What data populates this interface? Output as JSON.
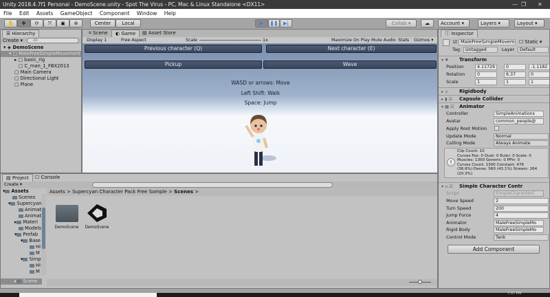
{
  "window": {
    "title": "Unity 2018.4.7f1 Personal - DemoScene.unity - Spot The Virus - PC, Mac & Linux Standalone <DX11>",
    "minimize": "—",
    "maximize": "❐",
    "close": "✕"
  },
  "menu": [
    "File",
    "Edit",
    "Assets",
    "GameObject",
    "Component",
    "Window",
    "Help"
  ],
  "toolbar": {
    "tools": [
      "hand-tool",
      "move-tool",
      "rotate-tool",
      "scale-tool",
      "rect-tool",
      "transform-tool"
    ],
    "pivot": "Center",
    "space": "Local",
    "collab": "Collab ▾",
    "account": "Account",
    "layers": "Layers",
    "layout": "Layout",
    "accent": "#3a7fd5"
  },
  "hierarchy": {
    "tab": "Hierarchy",
    "create": "Create ▾",
    "search_placeholder": "All",
    "scene": "DemoScene",
    "items": [
      {
        "label": "MaleFreeSimpleMovement",
        "depth": 1,
        "selected": true
      },
      {
        "label": "basic_rig",
        "depth": 2
      },
      {
        "label": "C_man_1_FBX2013",
        "depth": 2
      },
      {
        "label": "Main Camera",
        "depth": 1
      },
      {
        "label": "Directional Light",
        "depth": 1
      },
      {
        "label": "Plane",
        "depth": 1
      }
    ]
  },
  "gameview": {
    "tabs": [
      "Scene",
      "Game",
      "Asset Store"
    ],
    "active_tab": "Game",
    "display": "Display 1",
    "aspect": "Free Aspect",
    "scale_label": "Scale",
    "scale_value": "1x",
    "toggles": [
      "Maximize On Play",
      "Mute Audio",
      "Stats",
      "Gizmos ▾"
    ],
    "buttons": {
      "prev": "Previous character (Q)",
      "next": "Next character (E)",
      "pickup": "Pickup",
      "wave": "Wave"
    },
    "instructions": [
      "WASD or arrows: Move",
      "Left Shift: Walk",
      "Space: Jump"
    ]
  },
  "project": {
    "tabs": [
      "Project",
      "Console"
    ],
    "create": "Create ▾",
    "tree": [
      {
        "label": "Assets",
        "depth": 0,
        "bold": true
      },
      {
        "label": "Scenes",
        "depth": 1
      },
      {
        "label": "Supercyan",
        "depth": 1
      },
      {
        "label": "Animat",
        "depth": 2
      },
      {
        "label": "Animat",
        "depth": 2
      },
      {
        "label": "Materi",
        "depth": 2
      },
      {
        "label": "Models",
        "depth": 2
      },
      {
        "label": "Prefab",
        "depth": 2
      },
      {
        "label": "Base",
        "depth": 3
      },
      {
        "label": "Hi",
        "depth": 4
      },
      {
        "label": "M",
        "depth": 4
      },
      {
        "label": "Simp",
        "depth": 3
      },
      {
        "label": "Hi",
        "depth": 4
      },
      {
        "label": "M",
        "depth": 4
      },
      {
        "label": "Scene",
        "depth": 2
      }
    ],
    "breadcrumb": [
      "Assets",
      "Supercyan Character Pack Free Sample",
      "Scenes"
    ],
    "assets": [
      {
        "label": "DemoScene",
        "type": "folder"
      },
      {
        "label": "DemoScene",
        "type": "unity-scene"
      }
    ]
  },
  "inspector": {
    "tab": "Inspector",
    "object_name": "MaleFreeSimpleMoveme",
    "static_label": "Static",
    "tag_label": "Tag",
    "tag": "Untagged",
    "layer_label": "Layer",
    "layer": "Default",
    "transform": {
      "title": "Transform",
      "position_label": "Position",
      "rotation_label": "Rotation",
      "scale_label": "Scale",
      "position": [
        "4.11729",
        "0",
        "-1.1182"
      ],
      "rotation": [
        "0",
        "6.37",
        "0"
      ],
      "scale": [
        "1",
        "1",
        "1"
      ]
    },
    "rigidbody": "Rigidbody",
    "capsule": "Capsule Collider",
    "animator": {
      "title": "Animator",
      "controller_label": "Controller",
      "controller": "SimpleAnimations",
      "avatar_label": "Avatar",
      "avatar": "common_people@",
      "root_motion_label": "Apply Root Motion",
      "update_label": "Update Mode",
      "update": "Normal",
      "culling_label": "Culling Mode",
      "culling": "Always Animate",
      "info": "Clip Count: 10\nCurves Pos: 0 Quat: 0 Euler: 0 Scale: 0\nMuscles: 1300 Generic: 0 PPtr: 0\nCurves Count: 1300 Constant: 476\n(36.6%) Dense: 560 (43.1%) Stream: 264\n(20.3%)"
    },
    "controller": {
      "title": "Simple Character Contr",
      "script_label": "Script",
      "script": "SimpleCharacterC",
      "move_label": "Move Speed",
      "move": "2",
      "turn_label": "Turn Speed",
      "turn": "200",
      "jump_label": "Jump Force",
      "jump": "4",
      "animator_label": "Animator",
      "animator": "MaleFreeSimpleMo",
      "rb_label": "Rigid Body",
      "rb": "MaleFreeSimpleMo",
      "mode_label": "Control Mode",
      "mode": "Tank"
    },
    "add_component": "Add Component"
  },
  "taskbar": {
    "clock": "7:57 PM"
  }
}
